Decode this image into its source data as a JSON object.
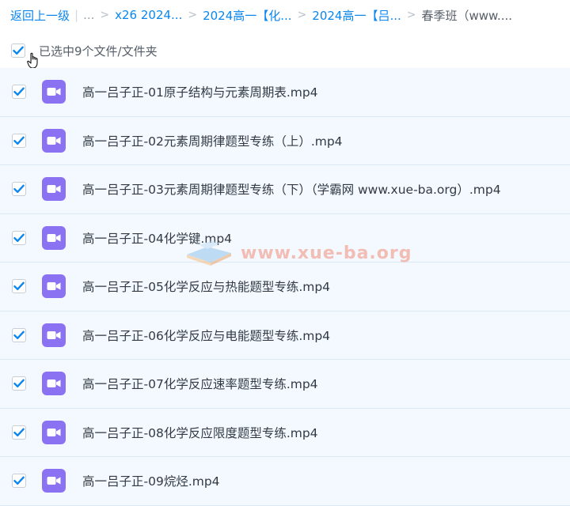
{
  "breadcrumb": {
    "back": "返回上一级",
    "dots": "...",
    "sep": ">",
    "items": [
      "x26 2024...",
      "2024高一【化...",
      "2024高一【吕...",
      "春季班（www...."
    ]
  },
  "selection": {
    "text": "已选中9个文件/文件夹",
    "all_checked": true
  },
  "files": [
    {
      "name": "高一吕子正-01原子结构与元素周期表.mp4",
      "checked": true,
      "icon": "video-file-icon"
    },
    {
      "name": "高一吕子正-02元素周期律题型专练（上）.mp4",
      "checked": true,
      "icon": "video-file-icon"
    },
    {
      "name": "高一吕子正-03元素周期律题型专练（下）（学霸网 www.xue-ba.org）.mp4",
      "checked": true,
      "icon": "video-file-icon"
    },
    {
      "name": "高一吕子正-04化学键.mp4",
      "checked": true,
      "icon": "video-file-icon"
    },
    {
      "name": "高一吕子正-05化学反应与热能题型专练.mp4",
      "checked": true,
      "icon": "video-file-icon"
    },
    {
      "name": "高一吕子正-06化学反应与电能题型专练.mp4",
      "checked": true,
      "icon": "video-file-icon"
    },
    {
      "name": "高一吕子正-07化学反应速率题型专练.mp4",
      "checked": true,
      "icon": "video-file-icon"
    },
    {
      "name": "高一吕子正-08化学反应限度题型专练.mp4",
      "checked": true,
      "icon": "video-file-icon"
    },
    {
      "name": "高一吕子正-09烷烃.mp4",
      "checked": true,
      "icon": "video-file-icon"
    }
  ],
  "watermark": {
    "text": "www.xue-ba.org"
  },
  "colors": {
    "link": "#0a86ef",
    "check": "#0a86ef",
    "icon_bg": "#8b72f2",
    "row_bg": "#f3f9fe"
  }
}
